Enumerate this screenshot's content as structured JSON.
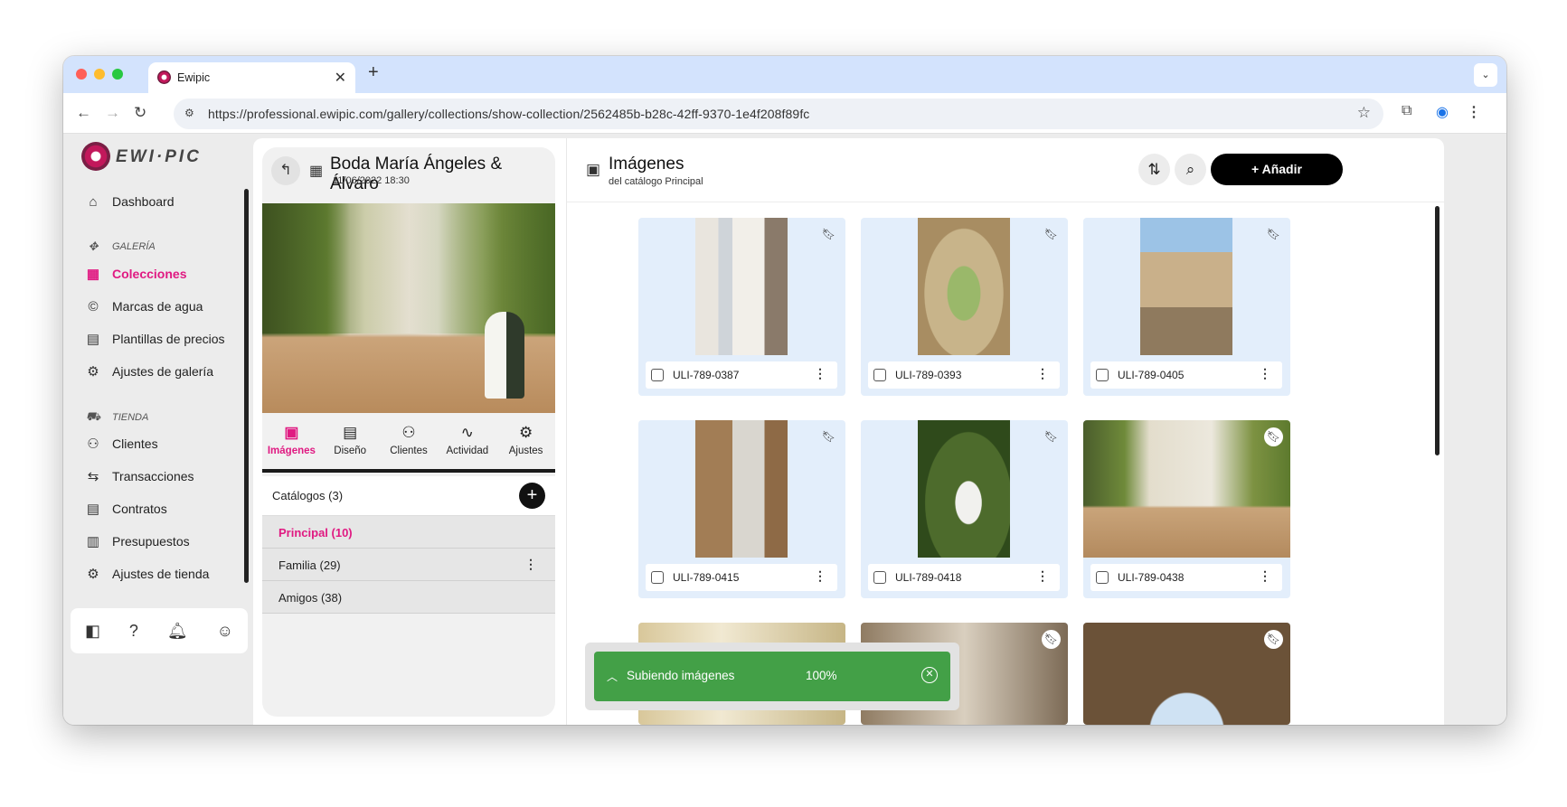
{
  "browser": {
    "tab_title": "Ewipic",
    "url": "https://professional.ewipic.com/gallery/collections/show-collection/2562485b-b28c-42ff-9370-1e4f208f89fc",
    "tab_close": "✕",
    "new_tab": "+"
  },
  "sidebar": {
    "logo_text": "EWI·PIC",
    "dashboard": "Dashboard",
    "gallery_section": "GALERÍA",
    "items_gallery": [
      {
        "label": "Colecciones",
        "icon": "grid-icon",
        "active": true
      },
      {
        "label": "Marcas de agua",
        "icon": "copyright-icon",
        "active": false
      },
      {
        "label": "Plantillas de precios",
        "icon": "price-doc-icon",
        "active": false
      },
      {
        "label": "Ajustes de galería",
        "icon": "gear-icon",
        "active": false
      }
    ],
    "store_section": "TIENDA",
    "items_store": [
      {
        "label": "Clientes",
        "icon": "user-icon"
      },
      {
        "label": "Transacciones",
        "icon": "transfer-icon"
      },
      {
        "label": "Contratos",
        "icon": "contract-icon"
      },
      {
        "label": "Presupuestos",
        "icon": "budget-icon"
      },
      {
        "label": "Ajustes de tienda",
        "icon": "gear-icon"
      }
    ]
  },
  "collection": {
    "title": "Boda María Ángeles & Álvaro",
    "date": "11/06/2022 18:30",
    "tabs": [
      {
        "label": "Imágenes",
        "icon": "image-icon",
        "active": true
      },
      {
        "label": "Diseño",
        "icon": "layout-icon",
        "active": false
      },
      {
        "label": "Clientes",
        "icon": "user-icon",
        "active": false
      },
      {
        "label": "Actividad",
        "icon": "activity-icon",
        "active": false
      },
      {
        "label": "Ajustes",
        "icon": "gear-icon",
        "active": false
      }
    ],
    "catalogs_label": "Catálogos (3)",
    "catalogs": [
      {
        "label": "Principal (10)",
        "active": true
      },
      {
        "label": "Familia (29)",
        "active": false
      },
      {
        "label": "Amigos (38)",
        "active": false
      }
    ]
  },
  "main": {
    "title": "Imágenes",
    "subtitle": "del catálogo Principal",
    "add_label": "+ Añadir",
    "images": [
      {
        "name": "ULI-789-0387"
      },
      {
        "name": "ULI-789-0393"
      },
      {
        "name": "ULI-789-0405"
      },
      {
        "name": "ULI-789-0415"
      },
      {
        "name": "ULI-789-0418"
      },
      {
        "name": "ULI-789-0438"
      }
    ]
  },
  "toast": {
    "label": "Subiendo imágenes",
    "percent": "100%",
    "progress": 1.0,
    "color": "#43a047"
  },
  "colors": {
    "accent": "#e01a82",
    "primary_button": "#000000"
  }
}
